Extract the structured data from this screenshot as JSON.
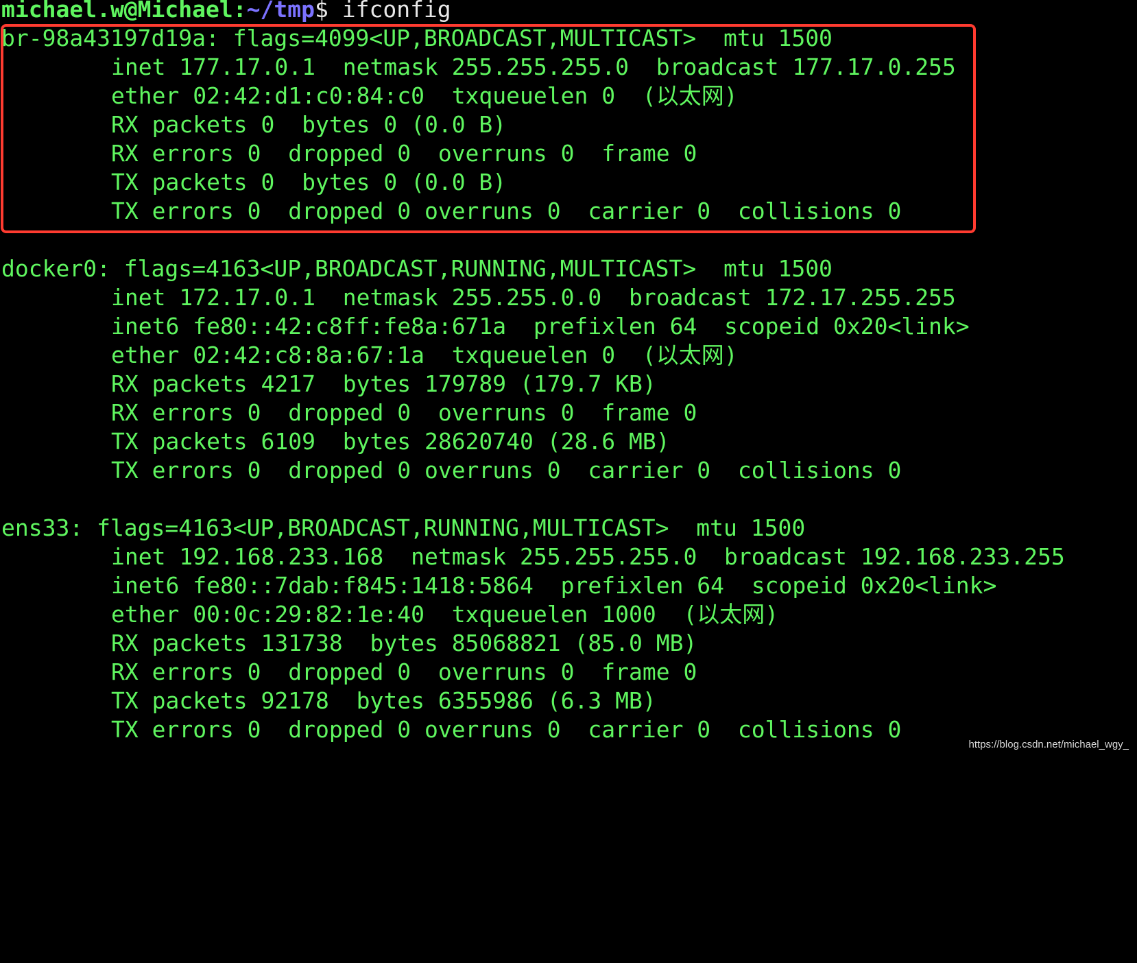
{
  "prompt": {
    "user_host": "michael.w@Michael",
    "colon": ":",
    "path": "~/tmp",
    "sign": "$",
    "command": " ifconfig"
  },
  "interfaces": [
    {
      "header": "br-98a43197d19a: flags=4099<UP,BROADCAST,MULTICAST>  mtu 1500",
      "lines": [
        "inet 177.17.0.1  netmask 255.255.255.0  broadcast 177.17.0.255",
        "ether 02:42:d1:c0:84:c0  txqueuelen 0  (以太网)",
        "RX packets 0  bytes 0 (0.0 B)",
        "RX errors 0  dropped 0  overruns 0  frame 0",
        "TX packets 0  bytes 0 (0.0 B)",
        "TX errors 0  dropped 0 overruns 0  carrier 0  collisions 0"
      ]
    },
    {
      "header": "docker0: flags=4163<UP,BROADCAST,RUNNING,MULTICAST>  mtu 1500",
      "lines": [
        "inet 172.17.0.1  netmask 255.255.0.0  broadcast 172.17.255.255",
        "inet6 fe80::42:c8ff:fe8a:671a  prefixlen 64  scopeid 0x20<link>",
        "ether 02:42:c8:8a:67:1a  txqueuelen 0  (以太网)",
        "RX packets 4217  bytes 179789 (179.7 KB)",
        "RX errors 0  dropped 0  overruns 0  frame 0",
        "TX packets 6109  bytes 28620740 (28.6 MB)",
        "TX errors 0  dropped 0 overruns 0  carrier 0  collisions 0"
      ]
    },
    {
      "header": "ens33: flags=4163<UP,BROADCAST,RUNNING,MULTICAST>  mtu 1500",
      "lines": [
        "inet 192.168.233.168  netmask 255.255.255.0  broadcast 192.168.233.255",
        "inet6 fe80::7dab:f845:1418:5864  prefixlen 64  scopeid 0x20<link>",
        "ether 00:0c:29:82:1e:40  txqueuelen 1000  (以太网)",
        "RX packets 131738  bytes 85068821 (85.0 MB)",
        "RX errors 0  dropped 0  overruns 0  frame 0",
        "TX packets 92178  bytes 6355986 (6.3 MB)",
        "TX errors 0  dropped 0 overruns 0  carrier 0  collisions 0"
      ]
    }
  ],
  "watermark": "https://blog.csdn.net/michael_wgy_",
  "colors": {
    "background": "#000000",
    "text": "#5ff55f",
    "path": "#7b72ff",
    "highlight": "#ff3b30"
  }
}
